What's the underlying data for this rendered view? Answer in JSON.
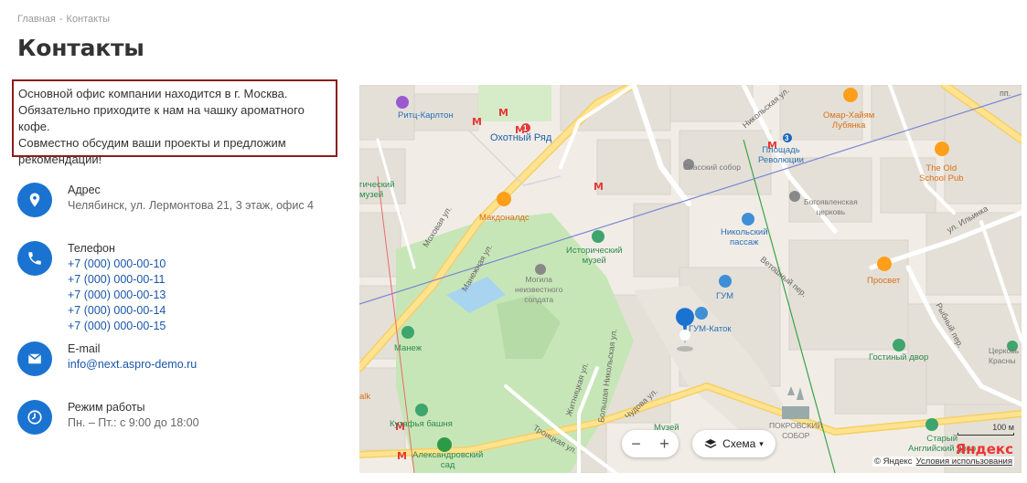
{
  "breadcrumb": {
    "home": "Главная",
    "separator": "-",
    "current": "Контакты"
  },
  "page": {
    "title": "Контакты"
  },
  "intro": {
    "lines": [
      "Основной офис компании находится в г. Москва.",
      "Обязательно приходите к нам на чашку ароматного кофе.",
      "Совместно обсудим ваши проекты и предложим",
      "рекомендации!"
    ]
  },
  "contacts": {
    "address": {
      "label": "Адрес",
      "value": "Челябинск, ул. Лермонтова 21, 3 этаж, офис 4",
      "icon": "location-pin-icon"
    },
    "phone": {
      "label": "Телефон",
      "numbers": [
        "+7 (000) 000-00-10",
        "+7 (000) 000-00-11",
        "+7 (000) 000-00-13",
        "+7 (000) 000-00-14",
        "+7 (000) 000-00-15"
      ],
      "icon": "phone-icon"
    },
    "email": {
      "label": "E-mail",
      "value": "info@next.aspro-demo.ru",
      "icon": "envelope-icon"
    },
    "hours": {
      "label": "Режим работы",
      "value": "Пн. – Пт.: с 9:00 до 18:00",
      "icon": "clock-icon"
    }
  },
  "map": {
    "labels": {
      "ritz": "Ритц-Карлтон",
      "okhotny": "Охотный Ряд",
      "mokhovaya": "Моховая ул.",
      "mac": "Макдоналдс",
      "hist_museum": "Исторический\nмузей",
      "grave": "Могила\nнеизвестного\nсолдата",
      "manege": "Манеж",
      "kutafya": "Кутафья башня",
      "aleks_garden": "Александровский\nсад",
      "spassky": "Спасский собор",
      "revolution": "Площадь\nРеволюции",
      "nikolsky": "Никольский\nпассаж",
      "gum": "ГУМ",
      "gum_katok": "ГУМ-Каток",
      "epiphany": "Богоявленская\nцерковь",
      "vetoshny": "Ветошный пер.",
      "prosvet": "Просвет",
      "omar": "Омар-Хайям\nЛубянка",
      "old_pub": "The Old\nSchool Pub",
      "gostiny": "Гостиный двор",
      "pokrov": "ПОКРОВСКИЙ\nСОБОР",
      "old_english": "Старый\nАнглийский двор",
      "nikolskaya": "Никольская ул.",
      "ilyinka": "ул. Ильинка",
      "rybny": "Рыбный пер.",
      "troitskaya": "Троицкая ул.",
      "churches": "Церковь\nКрасны",
      "manezhnaya": "Манежная ул.",
      "zhitnitskaya": "Житницкая ул.",
      "bolshaya_nik": "Большая Никольская ул.",
      "chudova": "Чудова ул.",
      "mus": "Музей",
      "logo_musei": "гический\nмузей",
      "talk": "alk",
      "pp": "пп.",
      "metro_line1": "1",
      "metro_line3": "3"
    },
    "controls": {
      "zoom_out": "−",
      "zoom_in": "+",
      "layer_label": "Схема",
      "layer_arrow": "▾"
    },
    "scale": "100 м",
    "brand": "Яндекс",
    "copyright": "© Яндекс",
    "terms": "Условия использования"
  }
}
